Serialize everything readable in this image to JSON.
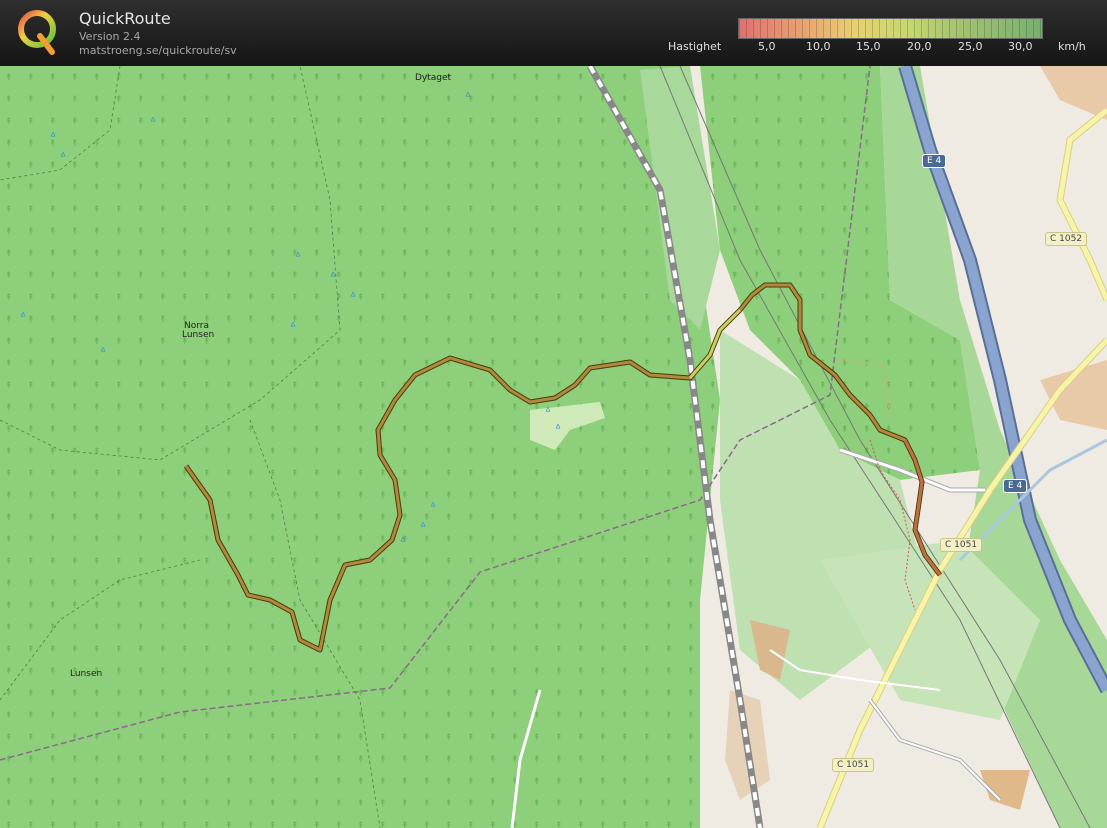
{
  "app": {
    "title": "QuickRoute",
    "version": "Version 2.4",
    "url": "matstroeng.se/quickroute/sv"
  },
  "legend": {
    "label": "Hastighet",
    "ticks": [
      "5,0",
      "10,0",
      "15,0",
      "20,0",
      "25,0",
      "30,0"
    ],
    "unit": "km/h"
  },
  "map": {
    "places": {
      "dytaget": "Dytaget",
      "norra_lunsen_1": "Norra",
      "norra_lunsen_2": "Lunsen",
      "lunsen": "Lunsen"
    },
    "road_shields": {
      "e4_top": "E 4",
      "e4_bottom": "E 4",
      "c1052": "C 1052",
      "c1051_mid": "C 1051",
      "c1051_bottom": "C 1051"
    },
    "colors": {
      "forest": "#8dcf7a",
      "open_land": "#efebe3",
      "motorway": "#8aa4d0",
      "route": "#8a6a2a"
    }
  }
}
